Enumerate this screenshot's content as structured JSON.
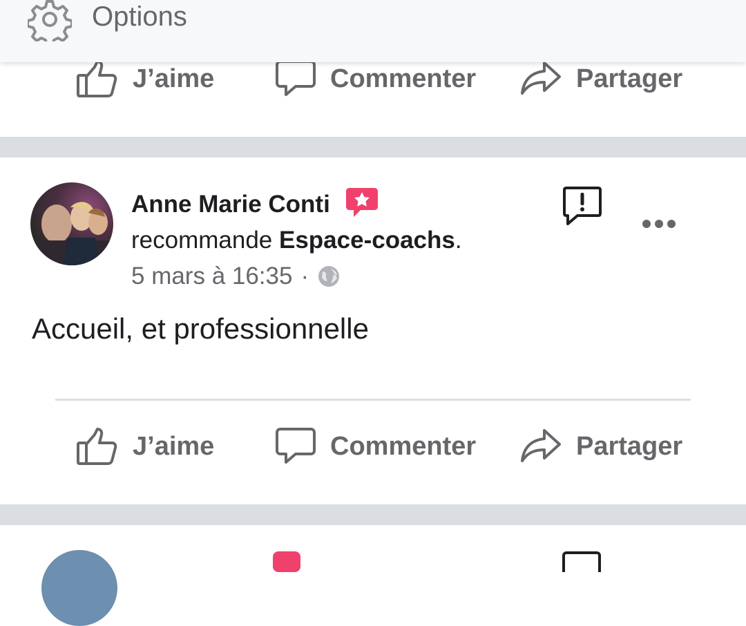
{
  "options_bar": {
    "label": "Options",
    "icon": "gear-icon"
  },
  "actions": {
    "like": "J’aime",
    "comment": "Commenter",
    "share": "Partager"
  },
  "post": {
    "author": "Anne Marie Conti",
    "recommend_prefix": "recommande ",
    "page_name": "Espace-coachs",
    "recommend_suffix": ".",
    "timestamp": "5 mars à 16:35",
    "separator_dot": "·",
    "privacy_icon": "globe-icon",
    "text": "Accueil, et professionnelle"
  },
  "colors": {
    "recommend_badge": "#f0416c",
    "secondary_text": "#65676b",
    "separator": "#dadde1"
  }
}
